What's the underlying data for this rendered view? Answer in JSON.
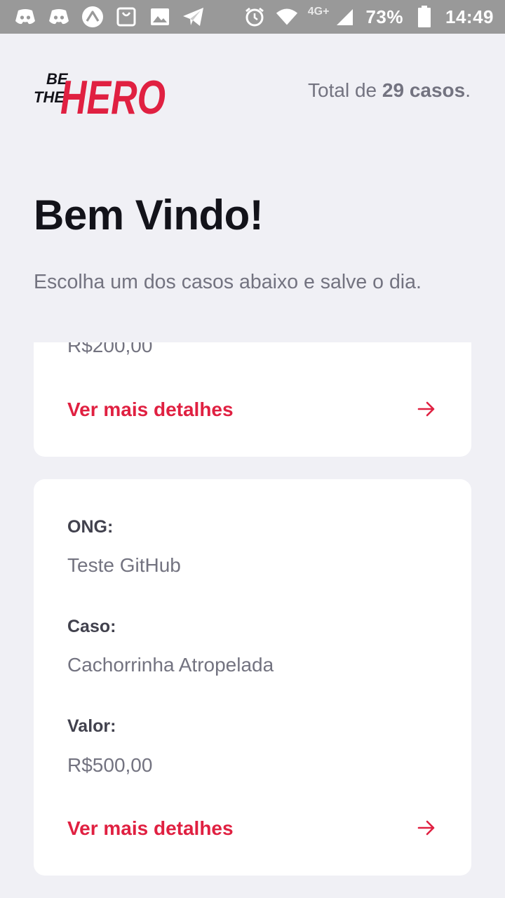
{
  "status_bar": {
    "network_badge": "4G+",
    "battery": "73%",
    "time": "14:49",
    "icons": [
      "discord-icon",
      "discord-icon",
      "expo-icon",
      "shopping-bag-icon",
      "image-icon",
      "telegram-icon",
      "alarm-icon",
      "wifi-icon",
      "signal-icon",
      "battery-icon"
    ]
  },
  "header": {
    "logo_line1": "BE",
    "logo_line2": "THE",
    "logo_word": "HERO",
    "total_prefix": "Total de ",
    "total_count": "29 casos",
    "total_suffix": "."
  },
  "title": "Bem Vindo!",
  "description": "Escolha um dos casos abaixo e salve o dia.",
  "incidents": [
    {
      "value": "R$200,00",
      "details_label": "Ver mais detalhes"
    },
    {
      "ong_label": "ONG:",
      "ong": "Teste GitHub",
      "case_label": "Caso:",
      "case": "Cachorrinha Atropelada",
      "value_label": "Valor:",
      "value": "R$500,00",
      "details_label": "Ver mais detalhes"
    }
  ],
  "colors": {
    "brand_red": "#e02041",
    "background": "#f0f0f5",
    "status_bar": "#999999"
  }
}
